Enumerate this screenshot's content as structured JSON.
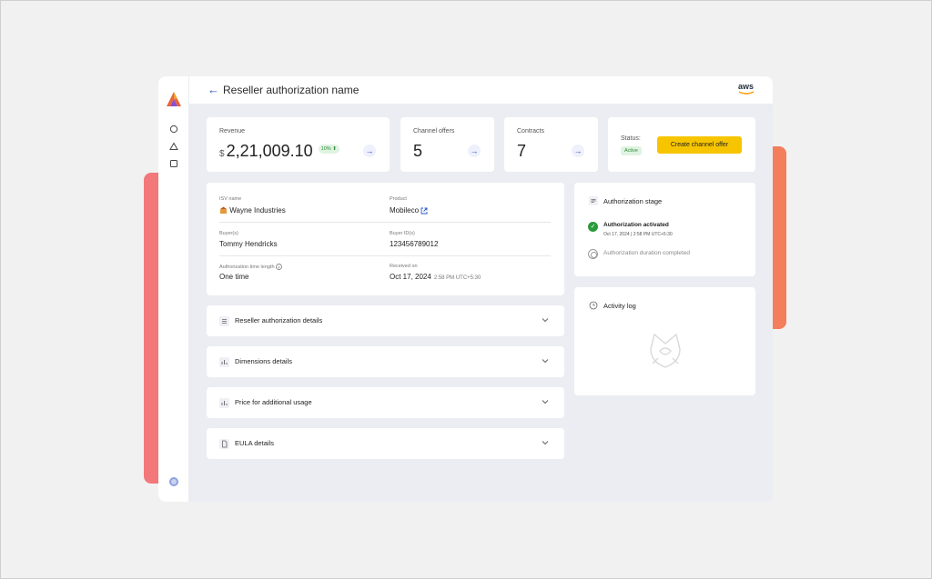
{
  "header": {
    "back_label": "←",
    "title": "Reseller authorization name",
    "aws_label": "aws"
  },
  "sidebar": {
    "items": [
      {
        "icon": "circle-icon"
      },
      {
        "icon": "triangle-icon"
      },
      {
        "icon": "square-icon"
      }
    ]
  },
  "stats": {
    "revenue": {
      "label": "Revenue",
      "currency": "$",
      "value": "2,21,009.10",
      "change": "10%"
    },
    "channel_offers": {
      "label": "Channel offers",
      "value": "5"
    },
    "contracts": {
      "label": "Contracts",
      "value": "7"
    },
    "status": {
      "label": "Status:",
      "badge": "Active",
      "button": "Create channel offer"
    }
  },
  "details": {
    "isv_name": {
      "label": "ISV name",
      "value": "Wayne Industries"
    },
    "product": {
      "label": "Product",
      "value": "Mobileco"
    },
    "buyers": {
      "label": "Buyer(s)",
      "value": "Tommy Hendricks"
    },
    "buyer_ids": {
      "label": "Buyer ID(s)",
      "value": "123456789012"
    },
    "auth_time": {
      "label": "Authorization time length",
      "value": "One time"
    },
    "received_on": {
      "label": "Received on",
      "date": "Oct 17, 2024",
      "time": "2:58 PM UTC+5:30"
    }
  },
  "accordions": [
    {
      "label": "Reseller authorization details"
    },
    {
      "label": "Dimensions details"
    },
    {
      "label": "Price for additional usage"
    },
    {
      "label": "EULA details"
    }
  ],
  "authorization_stage": {
    "title": "Authorization stage",
    "steps": [
      {
        "title": "Authorization activated",
        "time": "Oct 17, 2024 | 2:58 PM UTC+5:30"
      },
      {
        "title": "Authorization duration completed"
      }
    ]
  },
  "activity_log": {
    "title": "Activity log"
  },
  "colors": {
    "accent": "#2b55c9",
    "cta": "#f7c500",
    "success": "#2a9b3b",
    "deco_left": "#f2787a",
    "deco_right": "#f47d5c"
  }
}
